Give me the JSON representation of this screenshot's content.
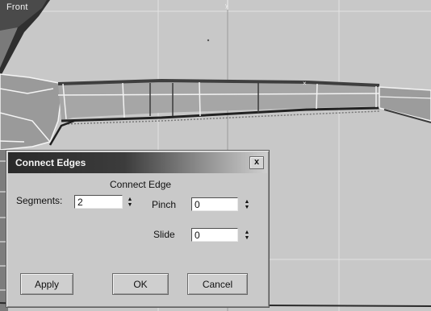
{
  "viewport": {
    "label": "Front",
    "icons": {
      "axis_marker": "y-axis-marker",
      "center": "x-center-marker"
    }
  },
  "dialog": {
    "title": "Connect Edges",
    "close_label": "x",
    "group_label": "Connect Edge",
    "segments": {
      "label": "Segments:",
      "value": "2"
    },
    "pinch": {
      "label": "Pinch",
      "value": "0"
    },
    "slide": {
      "label": "Slide",
      "value": "0"
    },
    "buttons": {
      "apply": "Apply",
      "ok": "OK",
      "cancel": "Cancel"
    }
  }
}
